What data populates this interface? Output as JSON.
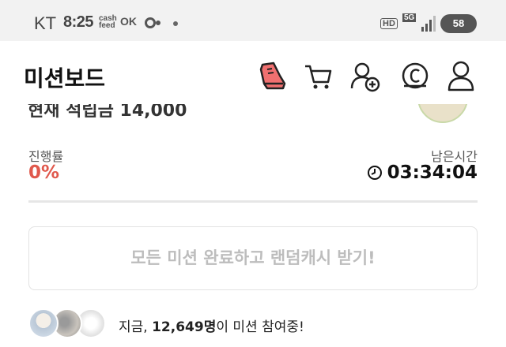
{
  "status_bar": {
    "carrier": "KT",
    "time": "8:25",
    "cashfeed_line1": "cash",
    "cashfeed_line2": "feed",
    "ok_label": "OK",
    "hd_label": "HD",
    "network_label": "5G",
    "battery": "58"
  },
  "header": {
    "title": "미션보드",
    "icons": [
      "sneaker-icon",
      "cart-icon",
      "add-user-icon",
      "coin-icon",
      "profile-icon"
    ]
  },
  "peek": {
    "text": "현재 적립금 14,000"
  },
  "progress": {
    "label": "진행률",
    "value": "0%",
    "remaining_label": "남은시간",
    "remaining_value": "03:34:04"
  },
  "reward_button": {
    "label": "모든 미션 완료하고 랜덤캐시 받기!"
  },
  "participants": {
    "prefix": "지금, ",
    "count": "12,649명",
    "suffix": "이 미션 참여중!"
  },
  "colors": {
    "accent": "#e0584c",
    "disabled_text": "#bdbdbd"
  }
}
